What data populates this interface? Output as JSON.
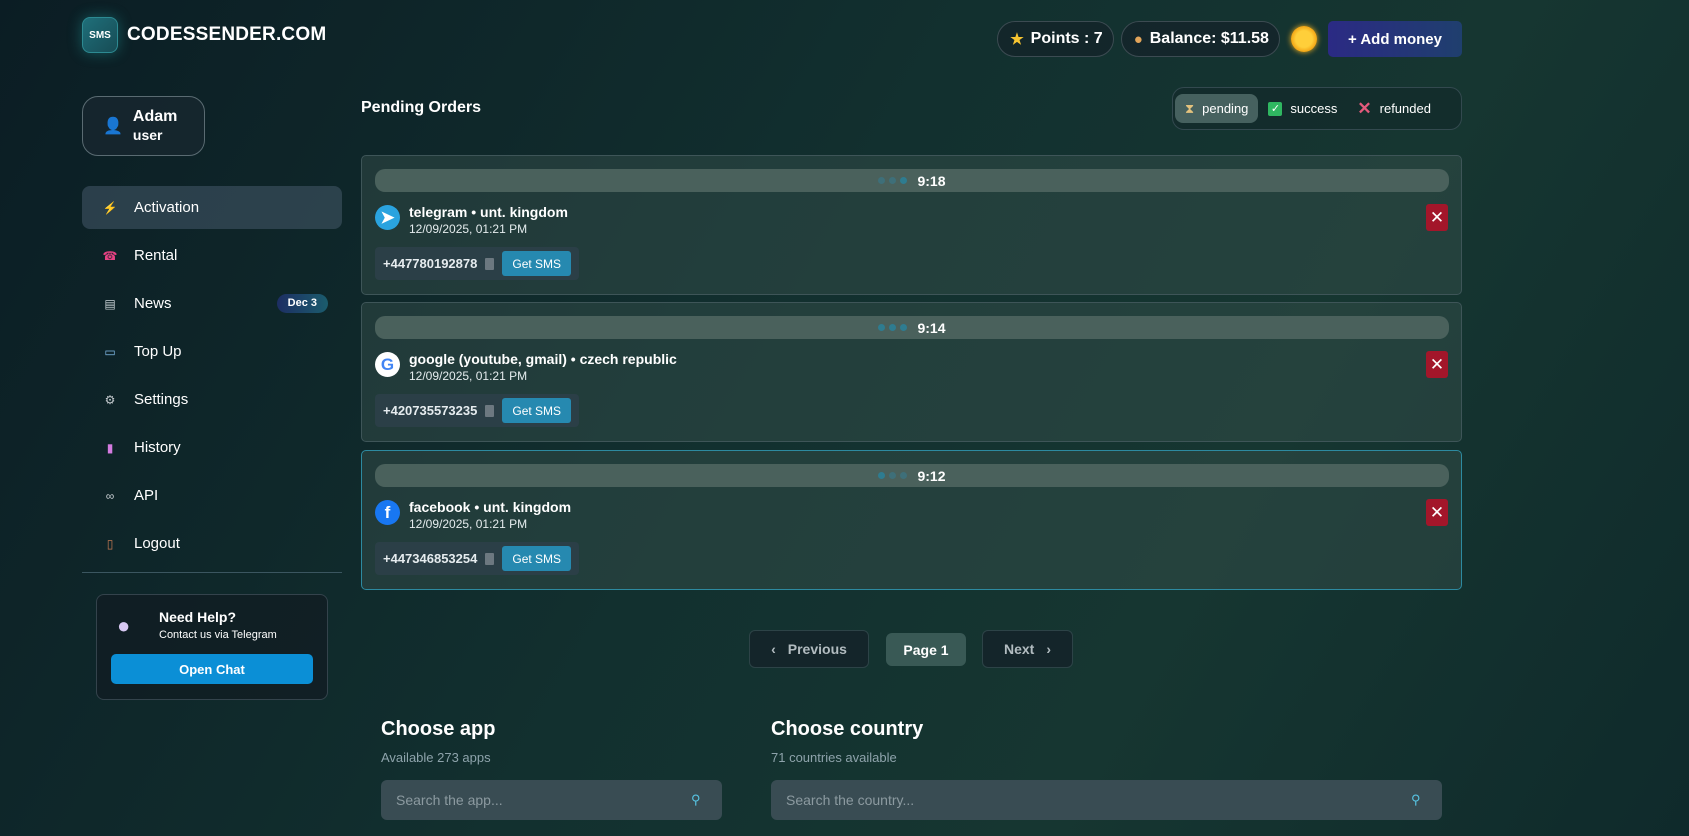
{
  "brand": {
    "badge": "SMS",
    "name": "CODESSENDER.COM"
  },
  "header": {
    "points_icon": "star-icon",
    "points": "Points : 7",
    "balance_icon": "money-bag-icon",
    "balance": "Balance: $11.58",
    "theme_icon": "sun-icon",
    "add_money": "+ Add money"
  },
  "user": {
    "name": "Adam",
    "role": "user"
  },
  "nav": [
    {
      "label": "Activation",
      "icon": "lightning-icon",
      "glyph": "⚡",
      "active": true
    },
    {
      "label": "Rental",
      "icon": "phone-icon",
      "glyph": "☎"
    },
    {
      "label": "News",
      "icon": "newspaper-icon",
      "glyph": "▤",
      "badge": "Dec 3"
    },
    {
      "label": "Top Up",
      "icon": "card-icon",
      "glyph": "▭"
    },
    {
      "label": "Settings",
      "icon": "gear-icon",
      "glyph": "⚙"
    },
    {
      "label": "History",
      "icon": "chart-icon",
      "glyph": "▮"
    },
    {
      "label": "API",
      "icon": "link-icon",
      "glyph": "🔗"
    },
    {
      "label": "Logout",
      "icon": "door-icon",
      "glyph": "▯"
    }
  ],
  "help": {
    "title": "Need Help?",
    "subtitle": "Contact us via Telegram",
    "button": "Open Chat"
  },
  "main": {
    "title": "Pending Orders",
    "filters": [
      {
        "label": "pending",
        "icon": "hourglass-icon",
        "active": true
      },
      {
        "label": "success",
        "icon": "checkbox-icon"
      },
      {
        "label": "refunded",
        "icon": "x-icon"
      }
    ]
  },
  "orders": [
    {
      "timer": "9:18",
      "app": "telegram • unt. kingdom",
      "date": "12/09/2025, 01:21 PM",
      "phone": "+447780192878",
      "icon": "telegram-icon",
      "get_sms": "Get SMS"
    },
    {
      "timer": "9:14",
      "app": "google (youtube, gmail) • czech republic",
      "date": "12/09/2025, 01:21 PM",
      "phone": "+420735573235",
      "icon": "google-icon",
      "get_sms": "Get SMS"
    },
    {
      "timer": "9:12",
      "app": "facebook • unt. kingdom",
      "date": "12/09/2025, 01:21 PM",
      "phone": "+447346853254",
      "icon": "facebook-icon",
      "get_sms": "Get SMS"
    }
  ],
  "pagination": {
    "previous": "Previous",
    "page": "Page 1",
    "next": "Next"
  },
  "choose_app": {
    "title": "Choose app",
    "subtitle": "Available 273 apps",
    "placeholder": "Search the app..."
  },
  "choose_country": {
    "title": "Choose country",
    "subtitle": "71 countries available",
    "placeholder": "Search the country..."
  },
  "colors": {
    "accent": "#2689b0",
    "cancel": "#a3162a",
    "chat": "#0b8fd6",
    "add_money": "#2b2a84"
  }
}
